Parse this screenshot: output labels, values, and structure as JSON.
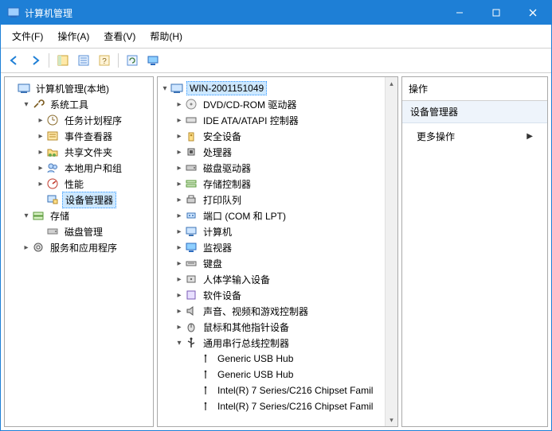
{
  "window": {
    "title": "计算机管理"
  },
  "menubar": {
    "file": "文件(F)",
    "action": "操作(A)",
    "view": "查看(V)",
    "help": "帮助(H)"
  },
  "left_tree": {
    "root": "计算机管理(本地)",
    "system_tools": {
      "label": "系统工具",
      "task_scheduler": "任务计划程序",
      "event_viewer": "事件查看器",
      "shared_folders": "共享文件夹",
      "local_users": "本地用户和组",
      "performance": "性能",
      "device_manager": "设备管理器"
    },
    "storage": {
      "label": "存储",
      "disk_mgmt": "磁盘管理"
    },
    "services_apps": "服务和应用程序"
  },
  "center_tree": {
    "root": "WIN-2001151049",
    "dvd": "DVD/CD-ROM 驱动器",
    "ide": "IDE ATA/ATAPI 控制器",
    "security": "安全设备",
    "processors": "处理器",
    "disk_drives": "磁盘驱动器",
    "storage_ctl": "存储控制器",
    "printers": "打印队列",
    "ports": "端口 (COM 和 LPT)",
    "computer": "计算机",
    "monitors": "监视器",
    "keyboards": "键盘",
    "hid": "人体学输入设备",
    "software": "软件设备",
    "audio": "声音、视频和游戏控制器",
    "mice": "鼠标和其他指针设备",
    "usb": {
      "label": "通用串行总线控制器",
      "items": [
        "Generic USB Hub",
        "Generic USB Hub",
        "Intel(R) 7 Series/C216 Chipset Famil",
        "Intel(R) 7 Series/C216 Chipset Famil"
      ]
    }
  },
  "actions": {
    "header": "操作",
    "group": "设备管理器",
    "more": "更多操作"
  }
}
